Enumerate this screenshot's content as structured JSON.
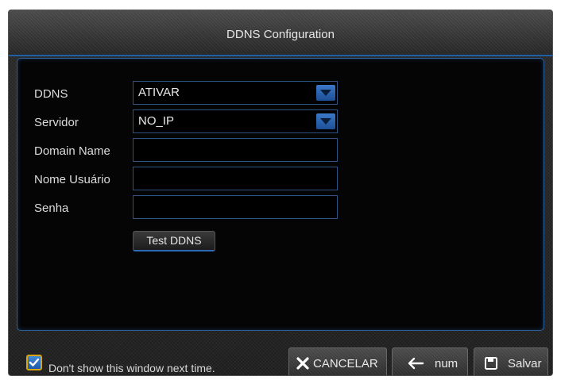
{
  "window": {
    "title": "DDNS Configuration"
  },
  "form": {
    "ddns": {
      "label": "DDNS",
      "value": "ATIVAR"
    },
    "server": {
      "label": "Servidor",
      "value": "NO_IP"
    },
    "domain": {
      "label": "Domain Name",
      "value": ""
    },
    "username": {
      "label": "Nome Usuário",
      "value": ""
    },
    "password": {
      "label": "Senha",
      "value": ""
    },
    "test_button": "Test DDNS"
  },
  "footer": {
    "dont_show_label": "Don't show this window next time.",
    "dont_show_checked": true,
    "cancel_label": "CANCELAR",
    "num_label": "num",
    "save_label": "Salvar"
  },
  "colors": {
    "accent": "#1f5fa8",
    "checkbox_border": "#d7a514"
  }
}
